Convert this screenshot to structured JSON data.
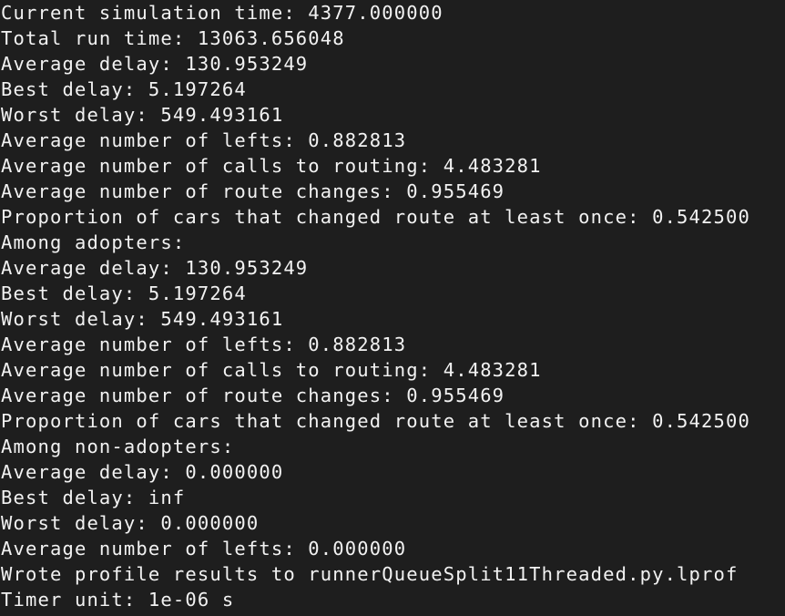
{
  "terminal": {
    "lines": [
      "Current simulation time: 4377.000000",
      "Total run time: 13063.656048",
      "Average delay: 130.953249",
      "Best delay: 5.197264",
      "Worst delay: 549.493161",
      "Average number of lefts: 0.882813",
      "Average number of calls to routing: 4.483281",
      "Average number of route changes: 0.955469",
      "Proportion of cars that changed route at least once: 0.542500",
      "Among adopters:",
      "Average delay: 130.953249",
      "Best delay: 5.197264",
      "Worst delay: 549.493161",
      "Average number of lefts: 0.882813",
      "Average number of calls to routing: 4.483281",
      "Average number of route changes: 0.955469",
      "Proportion of cars that changed route at least once: 0.542500",
      "Among non-adopters:",
      "Average delay: 0.000000",
      "Best delay: inf",
      "Worst delay: 0.000000",
      "Average number of lefts: 0.000000",
      "Wrote profile results to runnerQueueSplit11Threaded.py.lprof",
      "Timer unit: 1e-06 s"
    ]
  }
}
